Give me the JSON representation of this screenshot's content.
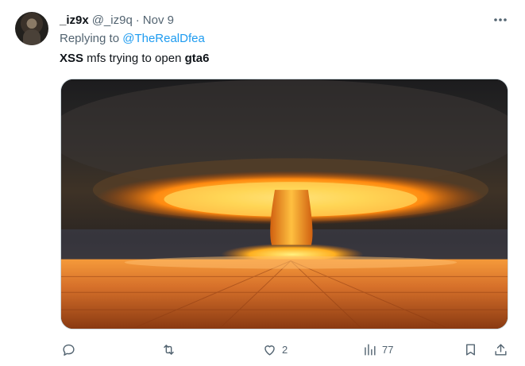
{
  "tweet": {
    "display_name": "_iz9x",
    "handle": "@_iz9q",
    "separator": "·",
    "date": "Nov 9",
    "reply_prefix": "Replying to",
    "reply_mention": "@TheRealDfea",
    "text_part1": "XSS",
    "text_part2": " mfs trying to open ",
    "text_part3": "gta6",
    "media_description": "nuclear-explosion-image"
  },
  "actions": {
    "reply": {
      "icon": "reply-icon",
      "count": ""
    },
    "retweet": {
      "icon": "retweet-icon",
      "count": ""
    },
    "like": {
      "icon": "heart-icon",
      "count": "2"
    },
    "views": {
      "icon": "views-icon",
      "count": "77"
    },
    "bookmark": {
      "icon": "bookmark-icon"
    },
    "share": {
      "icon": "share-icon"
    }
  },
  "colors": {
    "text_primary": "#0f1419",
    "text_secondary": "#536471",
    "link": "#1d9bf0",
    "border": "#cfd9de"
  }
}
